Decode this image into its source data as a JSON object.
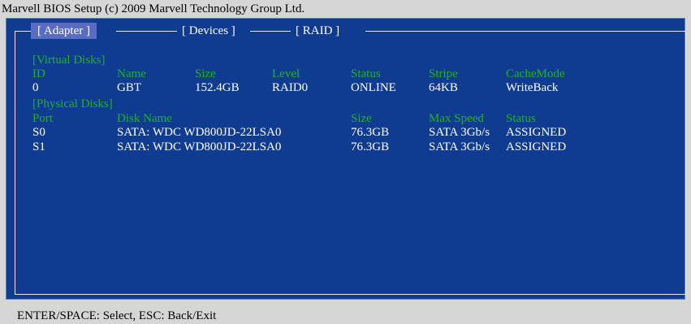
{
  "title": "Marvell BIOS Setup (c) 2009 Marvell Technology Group Ltd.",
  "tabs": [
    {
      "label": "[ Adapter ]",
      "active": true
    },
    {
      "label": "[ Devices ]",
      "active": false
    },
    {
      "label": "[  RAID  ]",
      "active": false
    }
  ],
  "virtual_disks": {
    "section_label": "[Virtual Disks]",
    "columns": [
      "ID",
      "Name",
      "Size",
      "Level",
      "Status",
      "Stripe",
      "CacheMode"
    ],
    "rows": [
      [
        "0",
        "GBT",
        "152.4GB",
        "RAID0",
        "ONLINE",
        "64KB",
        "WriteBack"
      ]
    ]
  },
  "physical_disks": {
    "section_label": "[Physical Disks]",
    "columns": [
      "Port",
      "Disk Name",
      "Size",
      "Max Speed",
      "Status"
    ],
    "rows": [
      [
        "S0",
        "SATA: WDC WD800JD-22LSA0",
        "76.3GB",
        "SATA 3Gb/s",
        "ASSIGNED"
      ],
      [
        "S1",
        "SATA: WDC WD800JD-22LSA0",
        "76.3GB",
        "SATA 3Gb/s",
        "ASSIGNED"
      ]
    ]
  },
  "status_bar": "ENTER/SPACE: Select, ESC: Back/Exit",
  "colors": {
    "panel_bg": "#0f3c91",
    "header_text": "#1fb31f",
    "value_text": "#ffffff",
    "active_tab_bg": "#5a6cc2",
    "chrome_bg": "#d6d6d6"
  }
}
